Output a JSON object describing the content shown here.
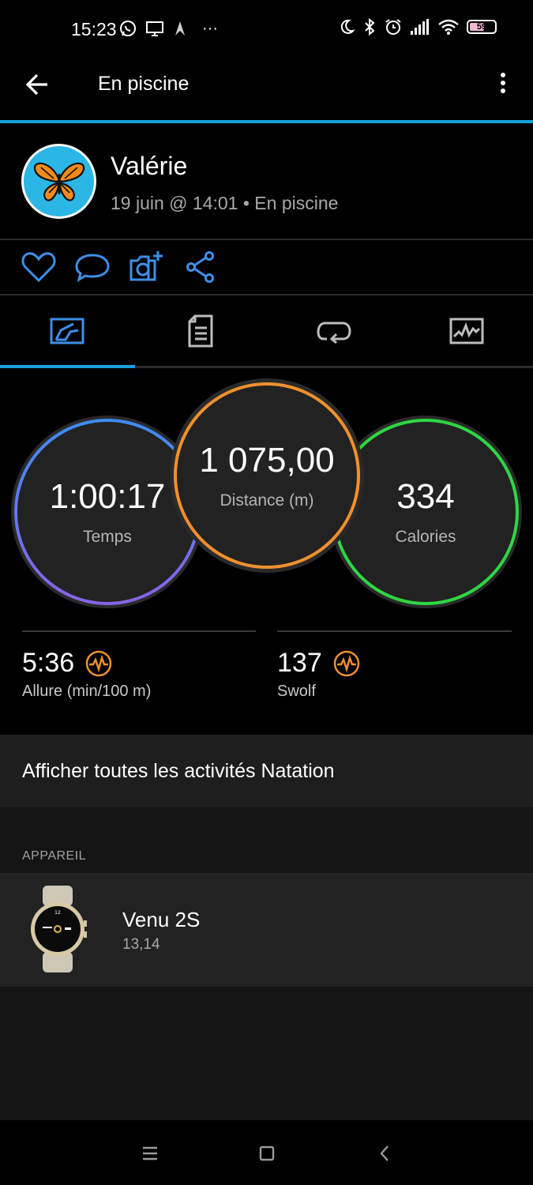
{
  "status_bar": {
    "time": "15:23",
    "more": "···",
    "battery": "59"
  },
  "app_bar": {
    "title": "En piscine"
  },
  "profile": {
    "name": "Valérie",
    "subtitle": "19 juin @ 14:01 • En piscine"
  },
  "actions": [
    "heart-icon",
    "comment-icon",
    "camera-add-icon",
    "share-icon"
  ],
  "tabs": [
    "overview-tab",
    "details-tab",
    "laps-tab",
    "charts-tab"
  ],
  "stats": {
    "time": {
      "value": "1:00:17",
      "label": "Temps"
    },
    "distance": {
      "value": "1 075,00",
      "label": "Distance (m)"
    },
    "calories": {
      "value": "334",
      "label": "Calories"
    }
  },
  "metrics": {
    "pace": {
      "value": "5:36",
      "label": "Allure (min/100 m)"
    },
    "swolf": {
      "value": "137",
      "label": "Swolf"
    }
  },
  "all_activities": "Afficher toutes les activités Natation",
  "device_section": {
    "label": "APPAREIL",
    "name": "Venu 2S",
    "version": "13,14"
  },
  "colors": {
    "accent": "#1a9ede",
    "time_ring": "#3d8df5",
    "distance_ring": "#f0902e",
    "calories_ring": "#2fd643",
    "metric_icon": "#f0902e",
    "action_icon": "#3e8fe8"
  }
}
